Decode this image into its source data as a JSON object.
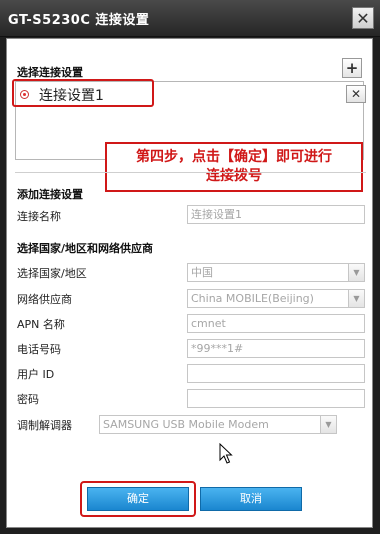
{
  "window": {
    "title": "GT-S5230C 连接设置",
    "close_glyph": "✕"
  },
  "connection_section": {
    "header": "选择连接设置",
    "add_glyph": "+",
    "items": [
      {
        "label": "连接设置1",
        "delete_glyph": "✕",
        "selected": true
      }
    ]
  },
  "annotation": {
    "line1": "第四步，点击【确定】即可进行",
    "line2": "连接拨号",
    "color": "#d01818"
  },
  "add_section": {
    "header": "添加连接设置",
    "name_label": "连接名称",
    "name_value": "连接设置1"
  },
  "country_section": {
    "header": "选择国家/地区和网络供应商",
    "country_label": "选择国家/地区",
    "country_value": "中国",
    "provider_label": "网络供应商",
    "provider_value": "China MOBILE(Beijing)",
    "apn_label": "APN 名称",
    "apn_value": "cmnet",
    "phone_label": "电话号码",
    "phone_value": "*99***1#",
    "userid_label": "用户 ID",
    "userid_value": "",
    "password_label": "密码",
    "password_value": "",
    "modem_label": "调制解调器",
    "modem_value": "SAMSUNG USB Mobile Modem"
  },
  "buttons": {
    "ok": "确定",
    "cancel": "取消"
  },
  "colors": {
    "accent_button": "#1a86cf",
    "highlight": "#d01818"
  }
}
